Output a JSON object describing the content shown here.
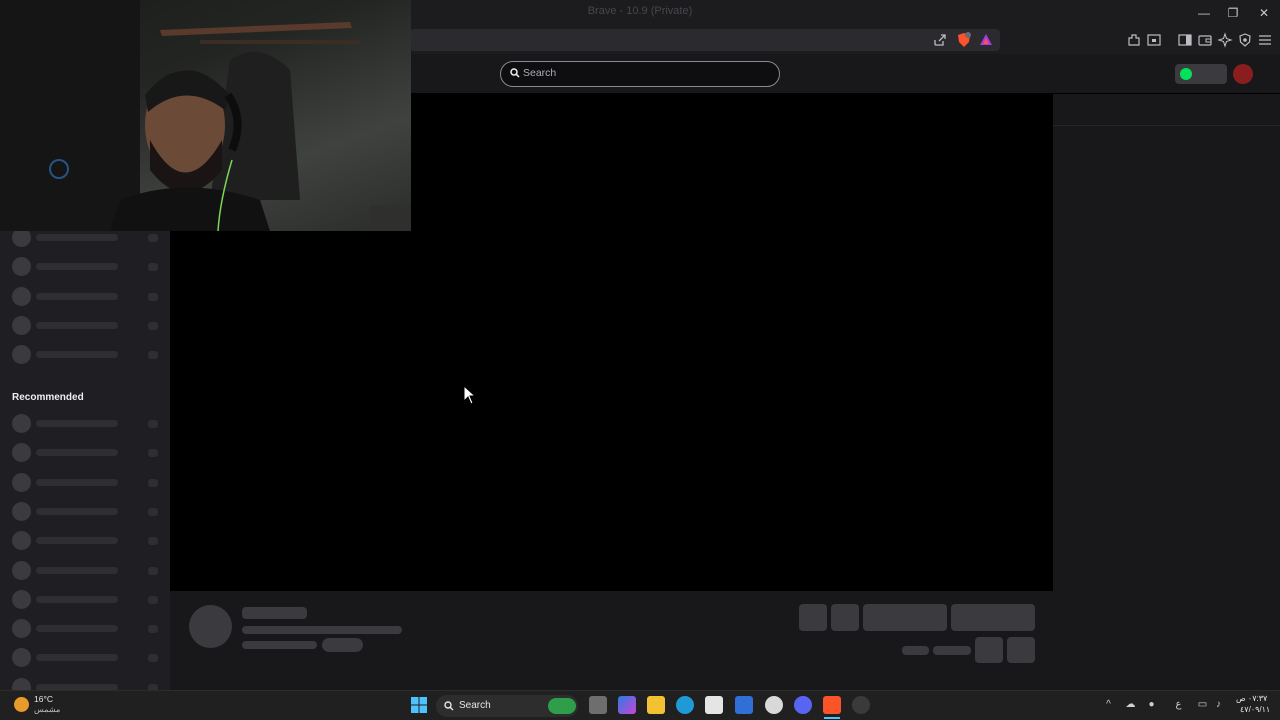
{
  "browser": {
    "window_title": "Brave - 10.9 (Private)",
    "min_glyph": "—",
    "max_glyph": "❐",
    "close_glyph": "✕"
  },
  "site_header": {
    "search_placeholder": "Search"
  },
  "sidebar": {
    "recommended_label": "Recommended",
    "followed_rows": 5,
    "recommended_rows": 10
  },
  "taskbar": {
    "weather_temp": "16°C",
    "weather_desc": "مشمس",
    "search_label": "Search",
    "time": "٠٧:٣٧ ص",
    "date": "٤٧/٠٩/١١",
    "lang": "ع"
  },
  "icons": [
    "share-icon",
    "brave-shield-icon",
    "brave-rewards-icon",
    "extensions-icon",
    "tab-icon",
    "sidebar-icon",
    "wallet-icon",
    "leo-icon",
    "vpn-icon",
    "menu-icon",
    "search-icon",
    "windows-start-icon",
    "cursor-icon"
  ],
  "colors": {
    "accent_green": "#00e25a",
    "player_bg": "#000000",
    "sidebar_bg": "#1f1f23"
  }
}
